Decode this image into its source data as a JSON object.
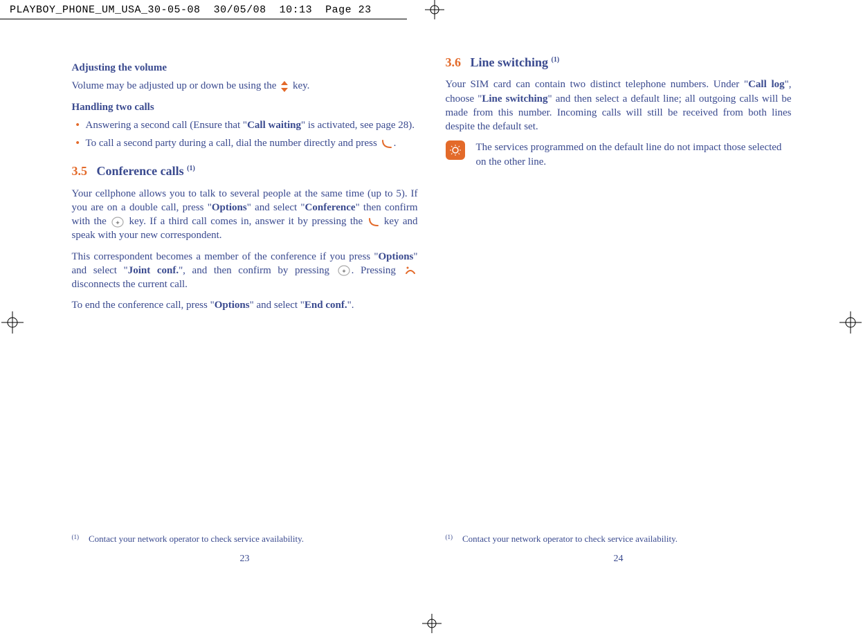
{
  "header": {
    "filename": "PLAYBOY_PHONE_UM_USA_30-05-08",
    "date": "30/05/08",
    "time": "10:13",
    "page_label": "Page 23"
  },
  "left": {
    "head1": "Adjusting the volume",
    "p1a": "Volume may be adjusted up or down be using the ",
    "p1b": " key.",
    "head2": "Handling two calls",
    "bullet1a": "Answering a second call (Ensure that \"",
    "bullet1_bold": "Call waiting",
    "bullet1b": "\" is activated, see page 28).",
    "bullet2a": "To call a second party during a call,  dial the number directly and press ",
    "bullet2b": ".",
    "sec35_num": "3.5",
    "sec35_title": "Conference calls ",
    "sec35_sup": "(1)",
    "p2a": "Your cellphone allows you to talk to several people at the same time (up to 5). If you are on a double call, press \"",
    "p2_opt": "Options",
    "p2b": "\" and select \"",
    "p2_conf": "Conference",
    "p2c": "\" then confirm with the ",
    "p2d": " key. If a third call comes in, answer it by pressing the ",
    "p2e": " key and speak with your new correspondent.",
    "p3a": "This correspondent becomes a member of the conference if you press \"",
    "p3_opt": "Options",
    "p3b": "\" and select \"",
    "p3_joint": "Joint conf.",
    "p3c": "\",  and then confirm by pressing ",
    "p3d": ". Pressing ",
    "p3e": " disconnects the current call.",
    "p4a": "To end the conference call,  press \"",
    "p4_opt": "Options",
    "p4b": "\" and select \"",
    "p4_end": "End conf.",
    "p4c": "\".",
    "footnote_mark": "(1)",
    "footnote_text": "Contact your network operator to check service availability.",
    "page_num": "23"
  },
  "right": {
    "sec36_num": "3.6",
    "sec36_title": "Line switching ",
    "sec36_sup": "(1)",
    "p1a": "Your SIM card can contain two distinct telephone numbers. Under \"",
    "p1_calllog": "Call log",
    "p1b": "\",  choose \"",
    "p1_ls": "Line switching",
    "p1c": "\" and then select a default line; all outgoing calls will be made from this number. Incoming calls will still be received from both lines despite the default set.",
    "note": "The services programmed on the default line do not impact those selected on the other line.",
    "footnote_mark": "(1)",
    "footnote_text": "Contact your network operator to check service availability.",
    "page_num": "24"
  }
}
